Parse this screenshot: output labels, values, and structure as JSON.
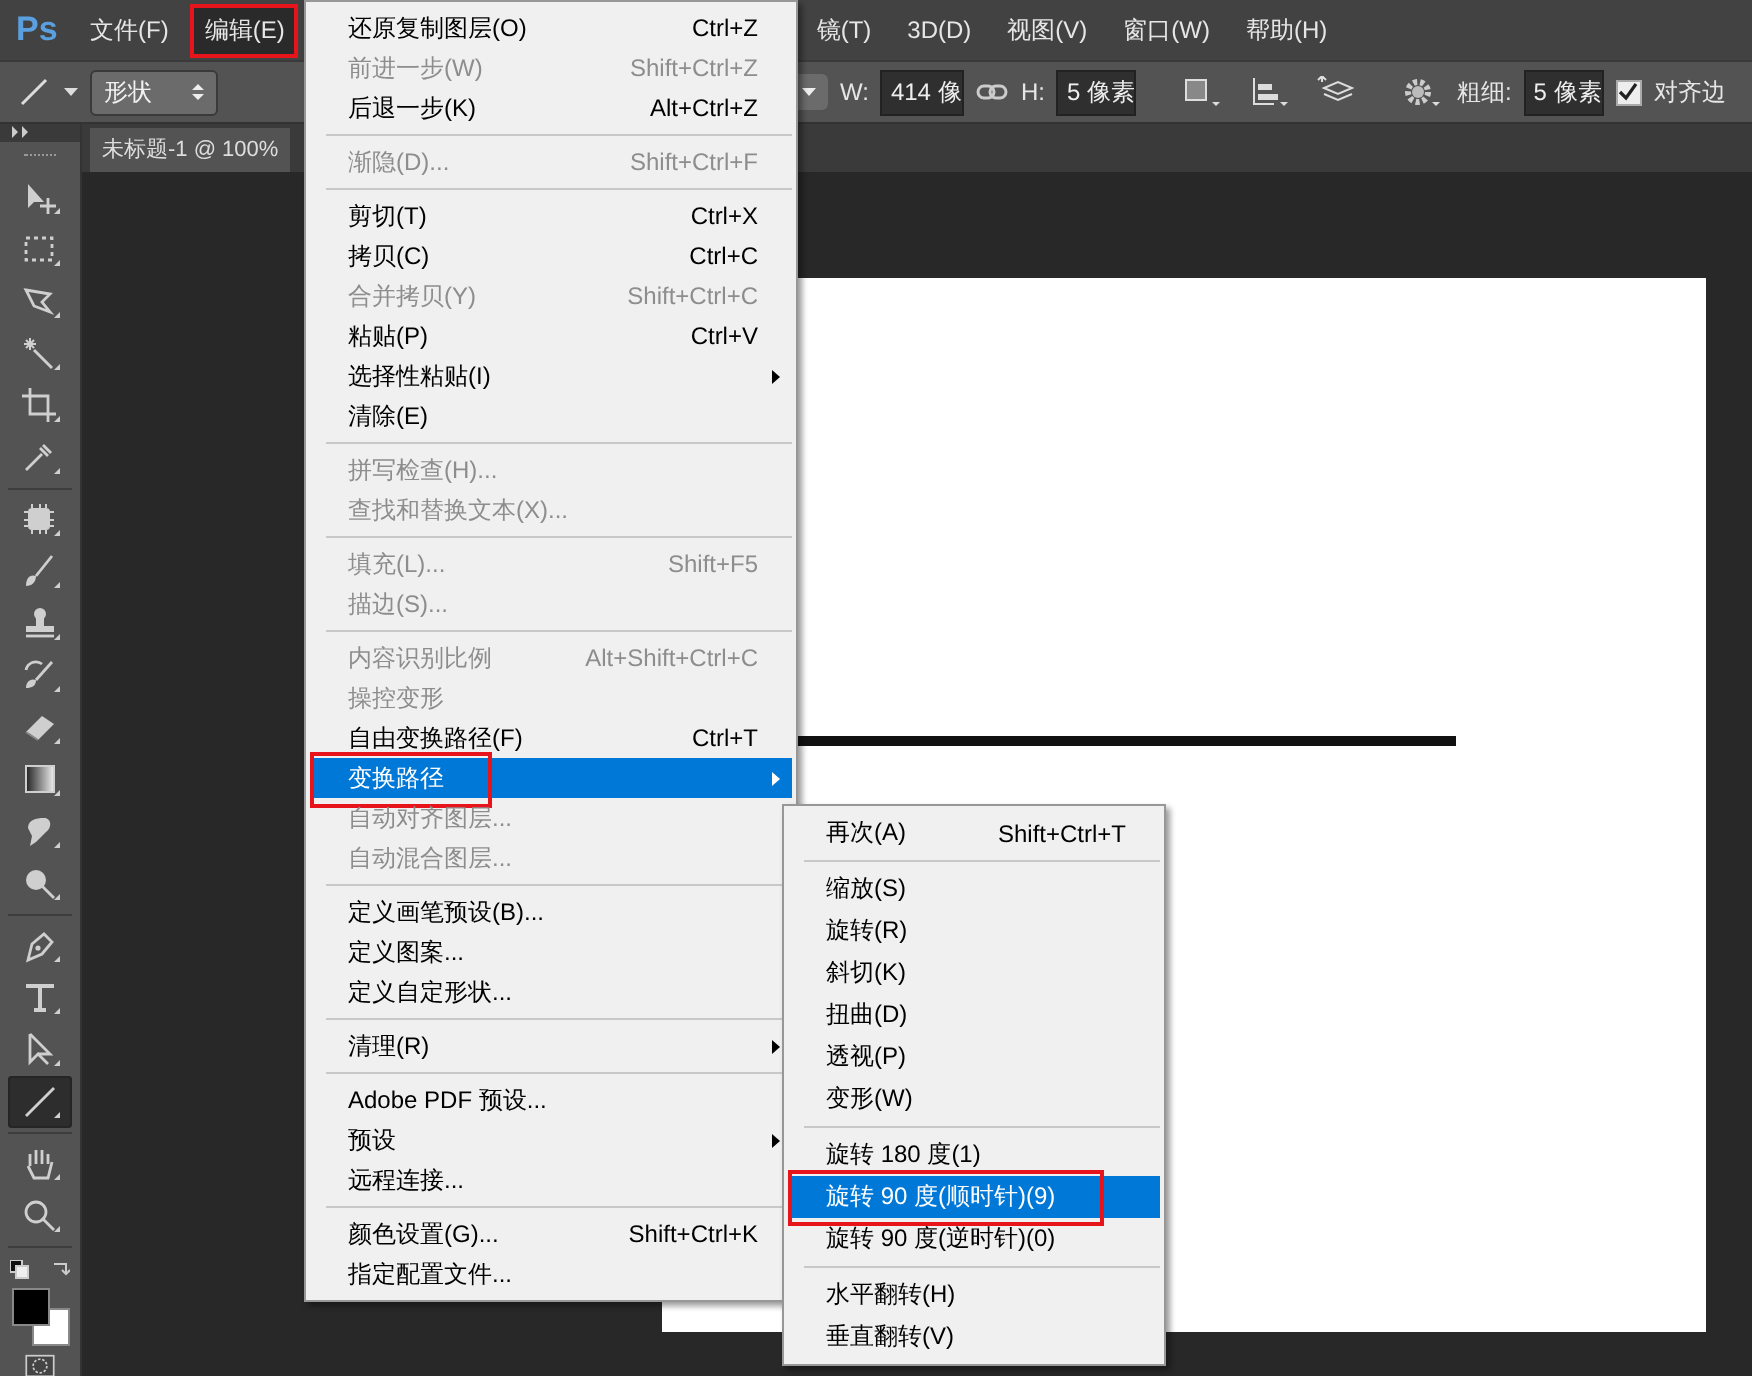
{
  "app": {
    "logo": "Ps"
  },
  "menubar": [
    {
      "label": "文件(F)",
      "selected": false,
      "annotated": false
    },
    {
      "label": "编辑(E)",
      "selected": true,
      "annotated": true
    },
    {
      "label": "镜(T)",
      "selected": false,
      "annotated": false
    },
    {
      "label": "3D(D)",
      "selected": false,
      "annotated": false
    },
    {
      "label": "视图(V)",
      "selected": false,
      "annotated": false
    },
    {
      "label": "窗口(W)",
      "selected": false,
      "annotated": false
    },
    {
      "label": "帮助(H)",
      "selected": false,
      "annotated": false
    }
  ],
  "options_bar": {
    "shape_mode": "形状",
    "w_label": "W:",
    "w_value": "414 像",
    "h_label": "H:",
    "h_value": "5 像素",
    "weight_label": "粗细:",
    "weight_value": "5 像素",
    "align_edges": {
      "label": "对齐边",
      "checked": true
    }
  },
  "document": {
    "tab": "未标题-1 @ 100%"
  },
  "tool_groups": [
    [
      {
        "kind": "move",
        "selected": false
      },
      {
        "kind": "marquee",
        "selected": false
      },
      {
        "kind": "lasso",
        "selected": false
      },
      {
        "kind": "wand",
        "selected": false
      },
      {
        "kind": "crop",
        "selected": false
      },
      {
        "kind": "eyedropper",
        "selected": false
      }
    ],
    [
      {
        "kind": "patch",
        "selected": false
      },
      {
        "kind": "brush",
        "selected": false
      },
      {
        "kind": "stamp",
        "selected": false
      },
      {
        "kind": "history",
        "selected": false
      },
      {
        "kind": "eraser",
        "selected": false
      },
      {
        "kind": "gradient",
        "selected": false
      },
      {
        "kind": "smudge",
        "selected": false
      },
      {
        "kind": "dodge",
        "selected": false
      }
    ],
    [
      {
        "kind": "pen",
        "selected": false
      },
      {
        "kind": "type",
        "selected": false
      },
      {
        "kind": "select",
        "selected": false
      },
      {
        "kind": "line",
        "selected": true
      }
    ],
    [
      {
        "kind": "hand",
        "selected": false
      },
      {
        "kind": "zoom",
        "selected": false
      }
    ]
  ],
  "edit_menu": [
    {
      "kind": "item",
      "label": "还原复制图层(O)",
      "shortcut": "Ctrl+Z",
      "disabled": false,
      "submenu": false,
      "selected": false,
      "annotated": false
    },
    {
      "kind": "item",
      "label": "前进一步(W)",
      "shortcut": "Shift+Ctrl+Z",
      "disabled": true,
      "submenu": false,
      "selected": false,
      "annotated": false
    },
    {
      "kind": "item",
      "label": "后退一步(K)",
      "shortcut": "Alt+Ctrl+Z",
      "disabled": false,
      "submenu": false,
      "selected": false,
      "annotated": false
    },
    {
      "kind": "separator"
    },
    {
      "kind": "item",
      "label": "渐隐(D)...",
      "shortcut": "Shift+Ctrl+F",
      "disabled": true,
      "submenu": false,
      "selected": false,
      "annotated": false
    },
    {
      "kind": "separator"
    },
    {
      "kind": "item",
      "label": "剪切(T)",
      "shortcut": "Ctrl+X",
      "disabled": false,
      "submenu": false,
      "selected": false,
      "annotated": false
    },
    {
      "kind": "item",
      "label": "拷贝(C)",
      "shortcut": "Ctrl+C",
      "disabled": false,
      "submenu": false,
      "selected": false,
      "annotated": false
    },
    {
      "kind": "item",
      "label": "合并拷贝(Y)",
      "shortcut": "Shift+Ctrl+C",
      "disabled": true,
      "submenu": false,
      "selected": false,
      "annotated": false
    },
    {
      "kind": "item",
      "label": "粘贴(P)",
      "shortcut": "Ctrl+V",
      "disabled": false,
      "submenu": false,
      "selected": false,
      "annotated": false
    },
    {
      "kind": "item",
      "label": "选择性粘贴(I)",
      "disabled": false,
      "submenu": true,
      "selected": false,
      "annotated": false
    },
    {
      "kind": "item",
      "label": "清除(E)",
      "disabled": false,
      "submenu": false,
      "selected": false,
      "annotated": false
    },
    {
      "kind": "separator"
    },
    {
      "kind": "item",
      "label": "拼写检查(H)...",
      "disabled": true,
      "submenu": false,
      "selected": false,
      "annotated": false
    },
    {
      "kind": "item",
      "label": "查找和替换文本(X)...",
      "disabled": true,
      "submenu": false,
      "selected": false,
      "annotated": false
    },
    {
      "kind": "separator"
    },
    {
      "kind": "item",
      "label": "填充(L)...",
      "shortcut": "Shift+F5",
      "disabled": true,
      "submenu": false,
      "selected": false,
      "annotated": false
    },
    {
      "kind": "item",
      "label": "描边(S)...",
      "disabled": true,
      "submenu": false,
      "selected": false,
      "annotated": false
    },
    {
      "kind": "separator"
    },
    {
      "kind": "item",
      "label": "内容识别比例",
      "shortcut": "Alt+Shift+Ctrl+C",
      "disabled": true,
      "submenu": false,
      "selected": false,
      "annotated": false
    },
    {
      "kind": "item",
      "label": "操控变形",
      "disabled": true,
      "submenu": false,
      "selected": false,
      "annotated": false
    },
    {
      "kind": "item",
      "label": "自由变换路径(F)",
      "shortcut": "Ctrl+T",
      "disabled": false,
      "submenu": false,
      "selected": false,
      "annotated": false
    },
    {
      "kind": "item",
      "label": "变换路径",
      "disabled": false,
      "submenu": true,
      "selected": true,
      "annotated": true
    },
    {
      "kind": "item",
      "label": "自动对齐图层...",
      "disabled": true,
      "submenu": false,
      "selected": false,
      "annotated": false
    },
    {
      "kind": "item",
      "label": "自动混合图层...",
      "disabled": true,
      "submenu": false,
      "selected": false,
      "annotated": false
    },
    {
      "kind": "separator"
    },
    {
      "kind": "item",
      "label": "定义画笔预设(B)...",
      "disabled": false,
      "submenu": false,
      "selected": false,
      "annotated": false
    },
    {
      "kind": "item",
      "label": "定义图案...",
      "disabled": false,
      "submenu": false,
      "selected": false,
      "annotated": false
    },
    {
      "kind": "item",
      "label": "定义自定形状...",
      "disabled": false,
      "submenu": false,
      "selected": false,
      "annotated": false
    },
    {
      "kind": "separator"
    },
    {
      "kind": "item",
      "label": "清理(R)",
      "disabled": false,
      "submenu": true,
      "selected": false,
      "annotated": false
    },
    {
      "kind": "separator"
    },
    {
      "kind": "item",
      "label": "Adobe PDF 预设...",
      "disabled": false,
      "submenu": false,
      "selected": false,
      "annotated": false
    },
    {
      "kind": "item",
      "label": "预设",
      "disabled": false,
      "submenu": true,
      "selected": false,
      "annotated": false
    },
    {
      "kind": "item",
      "label": "远程连接...",
      "disabled": false,
      "submenu": false,
      "selected": false,
      "annotated": false
    },
    {
      "kind": "separator"
    },
    {
      "kind": "item",
      "label": "颜色设置(G)...",
      "shortcut": "Shift+Ctrl+K",
      "disabled": false,
      "submenu": false,
      "selected": false,
      "annotated": false
    },
    {
      "kind": "item",
      "label": "指定配置文件...",
      "disabled": false,
      "submenu": false,
      "selected": false,
      "annotated": false
    }
  ],
  "transform_submenu": [
    {
      "kind": "item",
      "label": "再次(A)",
      "shortcut": "Shift+Ctrl+T",
      "disabled": false,
      "submenu": false,
      "selected": false,
      "annotated": false
    },
    {
      "kind": "separator"
    },
    {
      "kind": "item",
      "label": "缩放(S)",
      "disabled": false,
      "submenu": false,
      "selected": false,
      "annotated": false
    },
    {
      "kind": "item",
      "label": "旋转(R)",
      "disabled": false,
      "submenu": false,
      "selected": false,
      "annotated": false
    },
    {
      "kind": "item",
      "label": "斜切(K)",
      "disabled": false,
      "submenu": false,
      "selected": false,
      "annotated": false
    },
    {
      "kind": "item",
      "label": "扭曲(D)",
      "disabled": false,
      "submenu": false,
      "selected": false,
      "annotated": false
    },
    {
      "kind": "item",
      "label": "透视(P)",
      "disabled": false,
      "submenu": false,
      "selected": false,
      "annotated": false
    },
    {
      "kind": "item",
      "label": "变形(W)",
      "disabled": false,
      "submenu": false,
      "selected": false,
      "annotated": false
    },
    {
      "kind": "separator"
    },
    {
      "kind": "item",
      "label": "旋转 180 度(1)",
      "disabled": false,
      "submenu": false,
      "selected": false,
      "annotated": false
    },
    {
      "kind": "item",
      "label": "旋转 90 度(顺时针)(9)",
      "disabled": false,
      "submenu": false,
      "selected": true,
      "annotated": true
    },
    {
      "kind": "item",
      "label": "旋转 90 度(逆时针)(0)",
      "disabled": false,
      "submenu": false,
      "selected": false,
      "annotated": false
    },
    {
      "kind": "separator"
    },
    {
      "kind": "item",
      "label": "水平翻转(H)",
      "disabled": false,
      "submenu": false,
      "selected": false,
      "annotated": false
    },
    {
      "kind": "item",
      "label": "垂直翻转(V)",
      "disabled": false,
      "submenu": false,
      "selected": false,
      "annotated": false
    }
  ]
}
